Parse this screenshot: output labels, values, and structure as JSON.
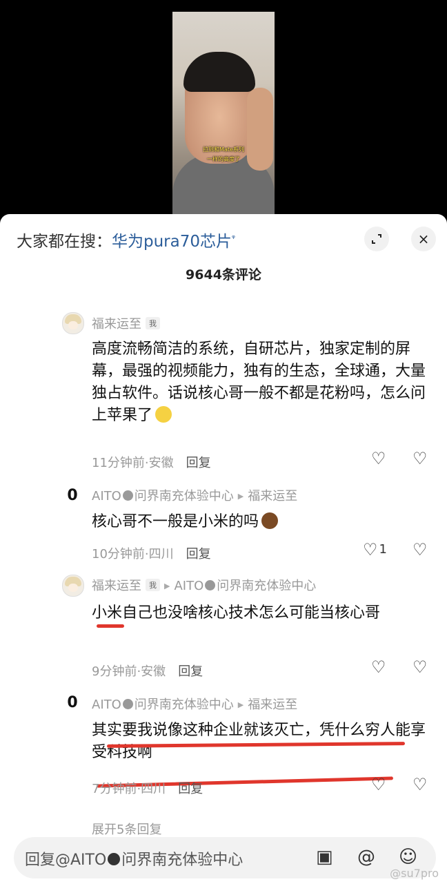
{
  "video": {
    "subtitle_line1": "拉到和Mate系列",
    "subtitle_line2": "一样的高度了"
  },
  "header": {
    "search_prefix": "大家都在搜：",
    "search_keyword": "华为pura70芯片",
    "search_icon": "ᵠ",
    "expand_icon": "expand-icon",
    "close_icon": "×",
    "comment_count": "9644条评论"
  },
  "comments": [
    {
      "user": "福来运至",
      "tag": "我",
      "reply_to": "",
      "avatar": "anime",
      "text": "高度流畅简洁的系统，自研芯片，独家定制的屏幕，最强的视频能力，独有的生态，全球通，大量独占软件。话说核心哥一般不都是花粉吗，怎么问上苹果了",
      "time": "11分钟前·安徽",
      "reply_label": "回复",
      "likes": ""
    },
    {
      "user": "AITO",
      "user_suffix": "问界南充体验中心",
      "tag": "",
      "reply_to": "福来运至",
      "avatar": "aito",
      "text": "核心哥不一般是小米的吗",
      "time": "10分钟前·四川",
      "reply_label": "回复",
      "likes": "1"
    },
    {
      "user": "福来运至",
      "tag": "我",
      "reply_to_prefix": "AITO",
      "reply_to": "问界南充体验中心",
      "avatar": "anime",
      "text": "小米自己也没啥核心技术怎么可能当核心哥",
      "time": "9分钟前·安徽",
      "reply_label": "回复",
      "likes": ""
    },
    {
      "user": "AITO",
      "user_suffix": "问界南充体验中心",
      "tag": "",
      "reply_to": "福来运至",
      "avatar": "aito",
      "text": "其实要我说像这种企业就该灭亡，凭什么穷人能享受科技啊",
      "time": "7分钟前·四川",
      "reply_label": "回复",
      "likes": ""
    }
  ],
  "more_replies": "展开5条回复",
  "input": {
    "placeholder_prefix": "回复@AITO",
    "placeholder_suffix": "问界南充体验中心"
  },
  "watermark": "@su7pro",
  "colors": {
    "keyword": "#2b5d9a",
    "annotation_red": "#e0362c"
  }
}
